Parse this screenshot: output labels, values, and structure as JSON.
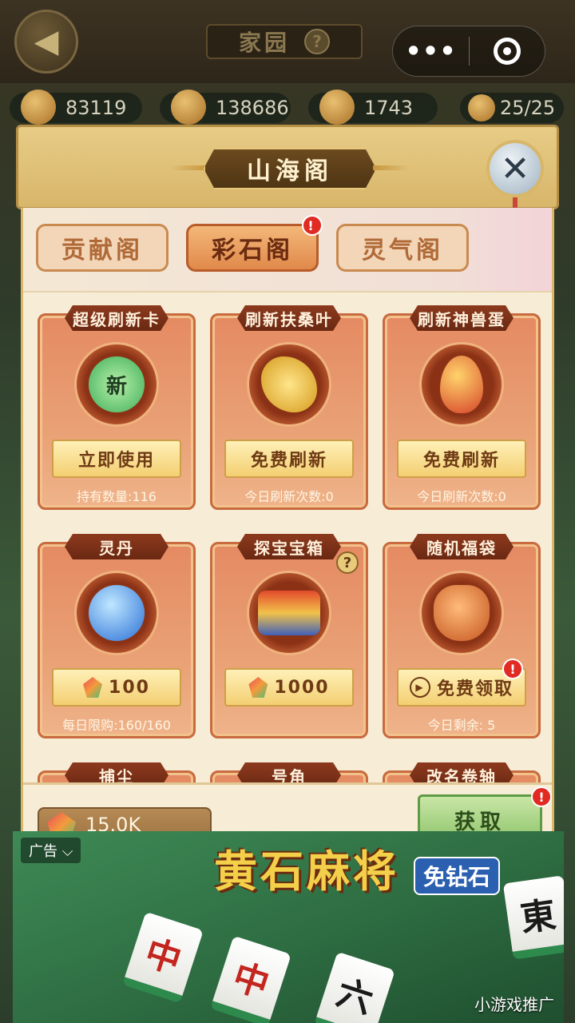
{
  "topbar": {
    "title": "家园",
    "help": "?",
    "wx_more": "•••"
  },
  "resources": [
    "83119",
    "138686",
    "1743",
    "25/25"
  ],
  "panel": {
    "title": "山海阁",
    "close": "✕",
    "tabs": [
      {
        "label": "贡献阁",
        "active": false
      },
      {
        "label": "彩石阁",
        "active": true,
        "badge": "!"
      },
      {
        "label": "灵气阁",
        "active": false
      }
    ],
    "cards": [
      {
        "title": "超级刷新卡",
        "icon": "flame-new-icon",
        "icon_text": "新",
        "button": "立即使用",
        "note": "持有数量:116"
      },
      {
        "title": "刷新扶桑叶",
        "icon": "golden-leaf-icon",
        "button": "免费刷新",
        "note": "今日刷新次数:0"
      },
      {
        "title": "刷新神兽蛋",
        "icon": "beast-egg-icon",
        "button": "免费刷新",
        "note": "今日刷新次数:0"
      },
      {
        "title": "灵丹",
        "icon": "spirit-pill-icon",
        "button": "100",
        "note": "每日限购:160/160"
      },
      {
        "title": "探宝宝箱",
        "icon": "treasure-chest-icon",
        "button": "1000",
        "note": ""
      },
      {
        "title": "随机福袋",
        "icon": "lucky-bag-icon",
        "button": "免费领取",
        "note": "今日剩余: 5"
      }
    ],
    "partial_titles": [
      "捕尘",
      "号角",
      "改名卷轴"
    ],
    "currency": "15.0K",
    "get_button": "获取",
    "card_badge": "!",
    "card_help": "?"
  },
  "ad": {
    "tag": "广告 ⌵",
    "title": "黄石麻将",
    "sub": "免钻石",
    "tiles": [
      "中",
      "中",
      "六",
      "東"
    ],
    "brand": "小游戏推广"
  }
}
